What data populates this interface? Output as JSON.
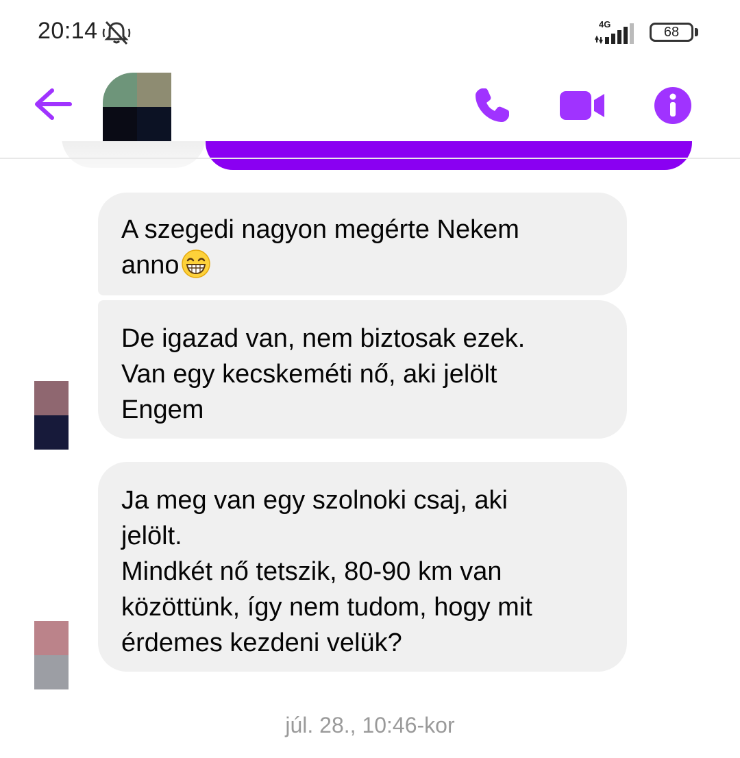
{
  "status_bar": {
    "time": "20:14",
    "network": "4G",
    "battery": "68"
  },
  "header": {
    "icons": [
      "back-arrow-icon",
      "phone-icon",
      "video-camera-icon",
      "info-icon"
    ],
    "accent_color": "#a033ff"
  },
  "messages": [
    {
      "text": "A szegedi nagyon megérte Nekem\nanno",
      "emoji": "grinning-face-with-smiling-eyes"
    },
    {
      "text": "De igazad van, nem biztosak ezek.\nVan egy kecskeméti nő, aki jelölt\nEngem"
    },
    {
      "text": "Ja meg van egy szolnoki csaj, aki\njelölt.\nMindkét nő tetszik, 80-90 km van\nközöttünk, így nem tudom, hogy mit\nérdemes kezdeni velük?"
    }
  ],
  "timestamp": "júl. 28., 10:46-kor",
  "colors": {
    "bubble_incoming": "#f0f0f0",
    "bubble_outgoing": "#8a00f2",
    "timestamp_text": "#9a9a9a"
  }
}
